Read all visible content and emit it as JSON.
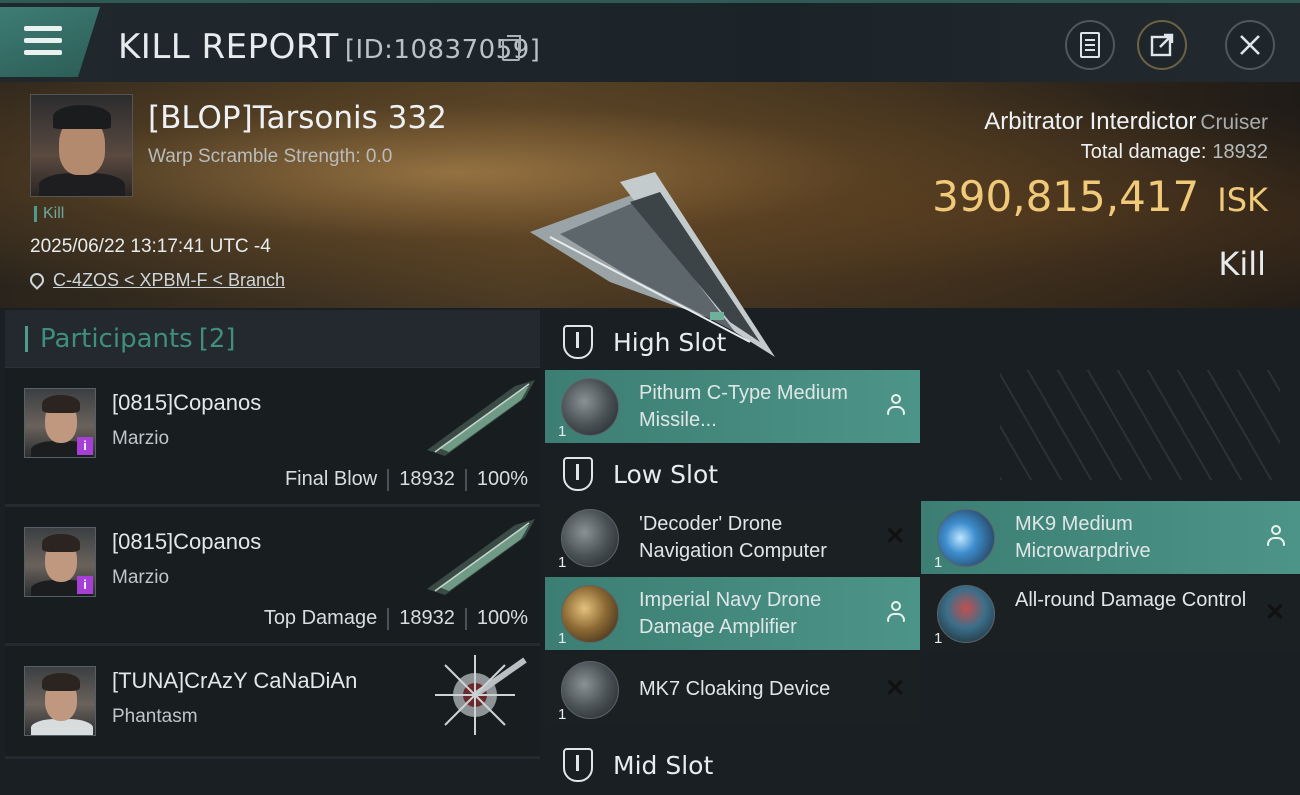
{
  "header": {
    "title": "KILL REPORT",
    "report_id": "[ID:10837059]",
    "icons": {
      "menu": "menu-icon",
      "copy": "copy-icon",
      "clipboard": "clipboard-icon",
      "share": "share-icon",
      "close": "close-icon"
    }
  },
  "victim": {
    "name": "[BLOP]Tarsonis 332",
    "warp_scramble": "Warp Scramble Strength: 0.0",
    "tag": "Kill",
    "datetime": "2025/06/22 13:17:41 UTC -4",
    "location": "C-4ZOS < XPBM-F < Branch",
    "ship_name": "Arbitrator Interdictor",
    "ship_class": "Cruiser",
    "total_damage_label": "Total damage:",
    "total_damage_value": "18932",
    "isk_value": "390,815,417",
    "isk_currency": "ISK",
    "result": "Kill"
  },
  "participants": {
    "title": "Participants",
    "count": "[2]",
    "rows": [
      {
        "name": "[0815]Copanos",
        "ship": "Marzio",
        "role": "Final Blow",
        "damage": "18932",
        "percent": "100%"
      },
      {
        "name": "[0815]Copanos",
        "ship": "Marzio",
        "role": "Top Damage",
        "damage": "18932",
        "percent": "100%"
      },
      {
        "name": "[TUNA]CrAzY CaNaDiAn",
        "ship": "Phantasm"
      }
    ]
  },
  "fitting": {
    "high_slot_label": "High Slot",
    "low_slot_label": "Low Slot",
    "mid_slot_label": "Mid Slot",
    "high": [
      {
        "name": "Pithum C-Type Medium Missile...",
        "qty": "1",
        "status": "dropped"
      }
    ],
    "low": [
      {
        "name": "'Decoder' Drone Navigation Computer",
        "qty": "1",
        "status": "destroyed"
      },
      {
        "name": "MK9 Medium Microwarpdrive",
        "qty": "1",
        "status": "dropped"
      },
      {
        "name": "Imperial Navy Drone Damage Amplifier",
        "qty": "1",
        "status": "dropped"
      },
      {
        "name": "All-round Damage Control",
        "qty": "1",
        "status": "destroyed"
      },
      {
        "name": "MK7 Cloaking Device",
        "qty": "1",
        "status": "destroyed"
      }
    ]
  },
  "colors": {
    "accent": "#4d9488",
    "isk": "#f0c979",
    "badge": "#a53fd6"
  }
}
